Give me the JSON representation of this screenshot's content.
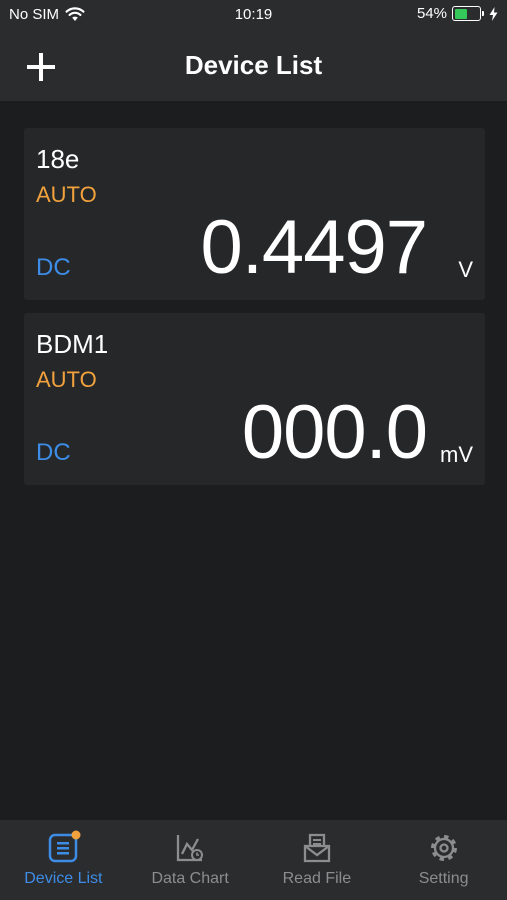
{
  "status_bar": {
    "carrier": "No SIM",
    "time": "10:19",
    "battery_percent": "54%",
    "battery_level": 0.54,
    "icons": [
      "wifi-icon",
      "battery-icon",
      "charging-bolt-icon"
    ]
  },
  "nav": {
    "title": "Device List",
    "add_icon": "plus-icon"
  },
  "devices": [
    {
      "name": "18e",
      "range": "AUTO",
      "mode": "DC",
      "reading": "0.4497",
      "unit": "V"
    },
    {
      "name": "BDM1",
      "range": "AUTO",
      "mode": "DC",
      "reading": "000.0",
      "unit": "mV"
    }
  ],
  "tabbar": {
    "tabs": [
      {
        "label": "Device List",
        "icon": "device-list-icon",
        "active": true
      },
      {
        "label": "Data Chart",
        "icon": "data-chart-icon",
        "active": false
      },
      {
        "label": "Read File",
        "icon": "read-file-icon",
        "active": false
      },
      {
        "label": "Setting",
        "icon": "gear-icon",
        "active": false
      }
    ]
  },
  "colors": {
    "background": "#1c1d1f",
    "bar": "#2b2c2e",
    "card": "#262729",
    "accent_blue": "#3d8ce6",
    "accent_orange": "#f2a23c",
    "battery_green": "#34c759"
  }
}
